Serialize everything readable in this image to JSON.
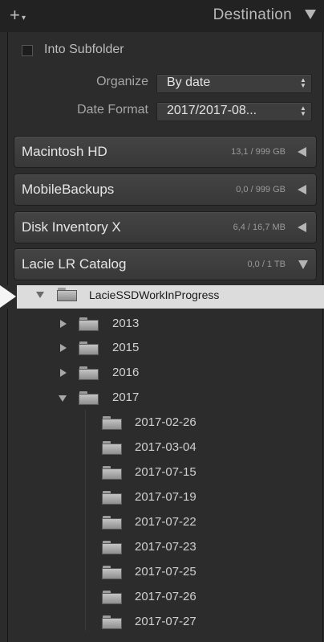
{
  "header": {
    "title": "Destination",
    "add_label": "+"
  },
  "options": {
    "into_subfolder_label": "Into Subfolder",
    "into_subfolder_checked": false,
    "organize_label": "Organize",
    "organize_value": "By date",
    "date_format_label": "Date Format",
    "date_format_value": "2017/2017-08..."
  },
  "volumes": [
    {
      "name": "Macintosh HD",
      "size": "13,1 / 999 GB",
      "expanded": false
    },
    {
      "name": "MobileBackups",
      "size": "0,0 / 999 GB",
      "expanded": false
    },
    {
      "name": "Disk Inventory X",
      "size": "6,4 / 16,7 MB",
      "expanded": false
    },
    {
      "name": "Lacie LR Catalog",
      "size": "0,0 / 1 TB",
      "expanded": true
    }
  ],
  "tree": {
    "selected_folder": "LacieSSDWorkInProgress",
    "years": [
      {
        "label": "2013",
        "expanded": false
      },
      {
        "label": "2015",
        "expanded": false
      },
      {
        "label": "2016",
        "expanded": false
      },
      {
        "label": "2017",
        "expanded": true
      }
    ],
    "dates": [
      "2017-02-26",
      "2017-03-04",
      "2017-07-15",
      "2017-07-19",
      "2017-07-22",
      "2017-07-23",
      "2017-07-25",
      "2017-07-26",
      "2017-07-27"
    ]
  },
  "colors": {
    "background": "#2b2b2b",
    "header": "#222222",
    "selection": "#dcdcdc"
  }
}
